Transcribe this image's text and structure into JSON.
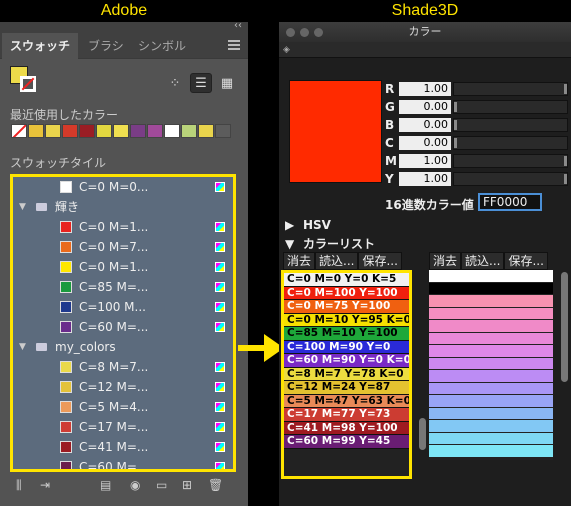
{
  "headers": {
    "left": "Adobe",
    "right": "Shade3D"
  },
  "adobe": {
    "topbar_dbl": "‹‹",
    "tabs": [
      "スウォッチ",
      "ブラシ",
      "シンボル"
    ],
    "recent_label": "最近使用したカラー",
    "recent_colors": [
      "none",
      "#e8c23a",
      "#e9d44c",
      "#d43a2a",
      "#9a1d24",
      "#e3d840",
      "#f0e050",
      "#7a3d86",
      "#a14a9a",
      "#ffffff",
      "#b9d37a",
      "#e9d44c",
      "#5c5c5c"
    ],
    "swatch_label": "スウォッチタイル",
    "rows": [
      {
        "kind": "swatch",
        "name": "C=0 M=0...",
        "color": "#ffffff"
      },
      {
        "kind": "group",
        "name": "輝き"
      },
      {
        "kind": "swatch",
        "name": "C=0 M=1...",
        "color": "#e8231f"
      },
      {
        "kind": "swatch",
        "name": "C=0 M=7...",
        "color": "#ea6a1c"
      },
      {
        "kind": "swatch",
        "name": "C=0 M=1...",
        "color": "#ffe600"
      },
      {
        "kind": "swatch",
        "name": "C=85 M=...",
        "color": "#1a9a3e"
      },
      {
        "kind": "swatch",
        "name": "C=100 M...",
        "color": "#1f3a8e"
      },
      {
        "kind": "swatch",
        "name": "C=60 M=...",
        "color": "#6a2c8c"
      },
      {
        "kind": "group",
        "name": "my_colors"
      },
      {
        "kind": "swatch",
        "name": "C=8 M=7...",
        "color": "#ead94a"
      },
      {
        "kind": "swatch",
        "name": "C=12 M=...",
        "color": "#e4c23a"
      },
      {
        "kind": "swatch",
        "name": "C=5 M=4...",
        "color": "#ec9a5a"
      },
      {
        "kind": "swatch",
        "name": "C=17 M=...",
        "color": "#cf3d35"
      },
      {
        "kind": "swatch",
        "name": "C=41 M=...",
        "color": "#9b1b22"
      },
      {
        "kind": "swatch",
        "name": "C=60 M=...",
        "color": "#6b1f4c"
      }
    ]
  },
  "shade": {
    "window_title": "カラー",
    "preview_color": "#ff2a00",
    "sliders": [
      {
        "label": "R",
        "value": "1.00",
        "level": 1.0
      },
      {
        "label": "G",
        "value": "0.00",
        "level": 0.0
      },
      {
        "label": "B",
        "value": "0.00",
        "level": 0.0
      },
      {
        "label": "C",
        "value": "0.00",
        "level": 0.0
      },
      {
        "label": "M",
        "value": "1.00",
        "level": 1.0
      },
      {
        "label": "Y",
        "value": "1.00",
        "level": 1.0
      }
    ],
    "hex_label": "16進数カラー値",
    "hex_value": "FF0000",
    "hsv_label": "HSV",
    "hsv_arrow": "▶",
    "list_label": "カラーリスト",
    "list_arrow": "▼",
    "buttons": [
      "消去",
      "読込...",
      "保存..."
    ],
    "list_left": [
      {
        "text": "C=0 M=0 Y=0 K=5",
        "bg": "#f2f2f2",
        "fg": "#000000"
      },
      {
        "text": "C=0 M=100 Y=100",
        "bg": "#f0200e",
        "fg": "#ffffff"
      },
      {
        "text": "C=0 M=75 Y=100",
        "bg": "#f06010",
        "fg": "#ffffff"
      },
      {
        "text": "C=0 M=10 Y=95 K=0",
        "bg": "#f6e000",
        "fg": "#000000"
      },
      {
        "text": "C=85 M=10 Y=100",
        "bg": "#1ea83a",
        "fg": "#000000"
      },
      {
        "text": "C=100 M=90 Y=0",
        "bg": "#2a2ad8",
        "fg": "#ffffff"
      },
      {
        "text": "C=60 M=90 Y=0 K=0",
        "bg": "#7a2ac6",
        "fg": "#ffffff"
      },
      {
        "text": "C=8 M=7 Y=78 K=0",
        "bg": "#ecdc40",
        "fg": "#000000"
      },
      {
        "text": "C=12 M=24 Y=87",
        "bg": "#e4c230",
        "fg": "#000000"
      },
      {
        "text": "C=5 M=47 Y=63 K=0",
        "bg": "#e88a58",
        "fg": "#000000"
      },
      {
        "text": "C=17 M=77 Y=73",
        "bg": "#cc3c32",
        "fg": "#ffffff"
      },
      {
        "text": "C=41 M=98 Y=100",
        "bg": "#9e1a20",
        "fg": "#ffffff"
      },
      {
        "text": "C=60 M=99 Y=45",
        "bg": "#6a1d74",
        "fg": "#ffffff"
      }
    ],
    "list_right": [
      "#ffffff",
      "#000000",
      "#f792b0",
      "#f58ec0",
      "#f08ac8",
      "#e888d8",
      "#de88e8",
      "#cc88f0",
      "#bc8cf4",
      "#a996f6",
      "#98a4f6",
      "#8ab6f4",
      "#82c8f4",
      "#7ed8f4",
      "#7ee6f6"
    ]
  }
}
